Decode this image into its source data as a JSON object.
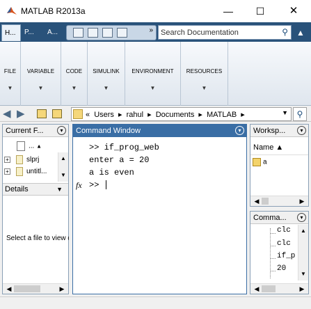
{
  "window": {
    "title": "MATLAB R2013a",
    "minimize": "—",
    "maximize": "☐",
    "close": "✕"
  },
  "ribbon": {
    "tabs": [
      {
        "label": "H..."
      },
      {
        "label": "P..."
      },
      {
        "label": "A..."
      }
    ],
    "quick_access_more": "»",
    "search_placeholder": "Search Documentation",
    "collapse": "▲",
    "groups": [
      {
        "label": "FILE"
      },
      {
        "label": "VARIABLE"
      },
      {
        "label": "CODE"
      },
      {
        "label": "SIMULINK"
      },
      {
        "label": "ENVIRONMENT"
      },
      {
        "label": "RESOURCES"
      }
    ]
  },
  "address": {
    "crumbs": [
      "«",
      "Users",
      "▸",
      "rahul",
      "▸",
      "Documents",
      "▸",
      "MATLAB",
      "▸"
    ]
  },
  "current_folder": {
    "title": "Current F...",
    "up_label": "...",
    "files": [
      {
        "name": "slprj"
      },
      {
        "name": "untitl..."
      }
    ],
    "details_label": "Details",
    "select_message": "Select a file to view details"
  },
  "command_window": {
    "title": "Command Window",
    "lines": [
      ">> if_prog_web",
      "enter a = 20",
      "a is even"
    ],
    "prompt": ">>",
    "fx": "fx"
  },
  "workspace": {
    "title": "Worksp...",
    "column_name": "Name ▲",
    "variables": [
      {
        "name": "a"
      }
    ]
  },
  "command_history": {
    "title": "Comma...",
    "items": [
      "clc",
      "clc",
      "if_p",
      "20"
    ]
  }
}
